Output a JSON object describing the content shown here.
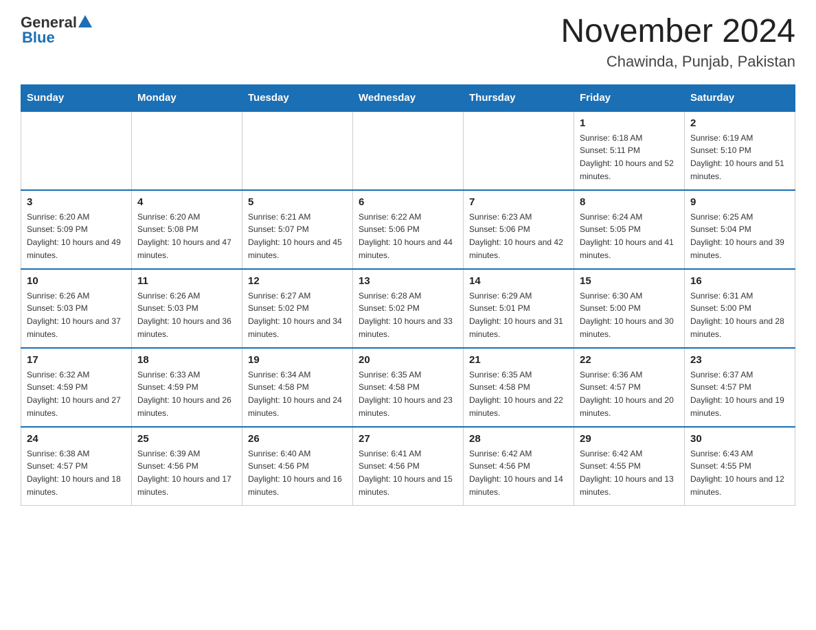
{
  "header": {
    "logo_general": "General",
    "logo_blue": "Blue",
    "title": "November 2024",
    "subtitle": "Chawinda, Punjab, Pakistan"
  },
  "days_of_week": [
    "Sunday",
    "Monday",
    "Tuesday",
    "Wednesday",
    "Thursday",
    "Friday",
    "Saturday"
  ],
  "weeks": [
    [
      {
        "day": "",
        "info": ""
      },
      {
        "day": "",
        "info": ""
      },
      {
        "day": "",
        "info": ""
      },
      {
        "day": "",
        "info": ""
      },
      {
        "day": "",
        "info": ""
      },
      {
        "day": "1",
        "info": "Sunrise: 6:18 AM\nSunset: 5:11 PM\nDaylight: 10 hours and 52 minutes."
      },
      {
        "day": "2",
        "info": "Sunrise: 6:19 AM\nSunset: 5:10 PM\nDaylight: 10 hours and 51 minutes."
      }
    ],
    [
      {
        "day": "3",
        "info": "Sunrise: 6:20 AM\nSunset: 5:09 PM\nDaylight: 10 hours and 49 minutes."
      },
      {
        "day": "4",
        "info": "Sunrise: 6:20 AM\nSunset: 5:08 PM\nDaylight: 10 hours and 47 minutes."
      },
      {
        "day": "5",
        "info": "Sunrise: 6:21 AM\nSunset: 5:07 PM\nDaylight: 10 hours and 45 minutes."
      },
      {
        "day": "6",
        "info": "Sunrise: 6:22 AM\nSunset: 5:06 PM\nDaylight: 10 hours and 44 minutes."
      },
      {
        "day": "7",
        "info": "Sunrise: 6:23 AM\nSunset: 5:06 PM\nDaylight: 10 hours and 42 minutes."
      },
      {
        "day": "8",
        "info": "Sunrise: 6:24 AM\nSunset: 5:05 PM\nDaylight: 10 hours and 41 minutes."
      },
      {
        "day": "9",
        "info": "Sunrise: 6:25 AM\nSunset: 5:04 PM\nDaylight: 10 hours and 39 minutes."
      }
    ],
    [
      {
        "day": "10",
        "info": "Sunrise: 6:26 AM\nSunset: 5:03 PM\nDaylight: 10 hours and 37 minutes."
      },
      {
        "day": "11",
        "info": "Sunrise: 6:26 AM\nSunset: 5:03 PM\nDaylight: 10 hours and 36 minutes."
      },
      {
        "day": "12",
        "info": "Sunrise: 6:27 AM\nSunset: 5:02 PM\nDaylight: 10 hours and 34 minutes."
      },
      {
        "day": "13",
        "info": "Sunrise: 6:28 AM\nSunset: 5:02 PM\nDaylight: 10 hours and 33 minutes."
      },
      {
        "day": "14",
        "info": "Sunrise: 6:29 AM\nSunset: 5:01 PM\nDaylight: 10 hours and 31 minutes."
      },
      {
        "day": "15",
        "info": "Sunrise: 6:30 AM\nSunset: 5:00 PM\nDaylight: 10 hours and 30 minutes."
      },
      {
        "day": "16",
        "info": "Sunrise: 6:31 AM\nSunset: 5:00 PM\nDaylight: 10 hours and 28 minutes."
      }
    ],
    [
      {
        "day": "17",
        "info": "Sunrise: 6:32 AM\nSunset: 4:59 PM\nDaylight: 10 hours and 27 minutes."
      },
      {
        "day": "18",
        "info": "Sunrise: 6:33 AM\nSunset: 4:59 PM\nDaylight: 10 hours and 26 minutes."
      },
      {
        "day": "19",
        "info": "Sunrise: 6:34 AM\nSunset: 4:58 PM\nDaylight: 10 hours and 24 minutes."
      },
      {
        "day": "20",
        "info": "Sunrise: 6:35 AM\nSunset: 4:58 PM\nDaylight: 10 hours and 23 minutes."
      },
      {
        "day": "21",
        "info": "Sunrise: 6:35 AM\nSunset: 4:58 PM\nDaylight: 10 hours and 22 minutes."
      },
      {
        "day": "22",
        "info": "Sunrise: 6:36 AM\nSunset: 4:57 PM\nDaylight: 10 hours and 20 minutes."
      },
      {
        "day": "23",
        "info": "Sunrise: 6:37 AM\nSunset: 4:57 PM\nDaylight: 10 hours and 19 minutes."
      }
    ],
    [
      {
        "day": "24",
        "info": "Sunrise: 6:38 AM\nSunset: 4:57 PM\nDaylight: 10 hours and 18 minutes."
      },
      {
        "day": "25",
        "info": "Sunrise: 6:39 AM\nSunset: 4:56 PM\nDaylight: 10 hours and 17 minutes."
      },
      {
        "day": "26",
        "info": "Sunrise: 6:40 AM\nSunset: 4:56 PM\nDaylight: 10 hours and 16 minutes."
      },
      {
        "day": "27",
        "info": "Sunrise: 6:41 AM\nSunset: 4:56 PM\nDaylight: 10 hours and 15 minutes."
      },
      {
        "day": "28",
        "info": "Sunrise: 6:42 AM\nSunset: 4:56 PM\nDaylight: 10 hours and 14 minutes."
      },
      {
        "day": "29",
        "info": "Sunrise: 6:42 AM\nSunset: 4:55 PM\nDaylight: 10 hours and 13 minutes."
      },
      {
        "day": "30",
        "info": "Sunrise: 6:43 AM\nSunset: 4:55 PM\nDaylight: 10 hours and 12 minutes."
      }
    ]
  ]
}
